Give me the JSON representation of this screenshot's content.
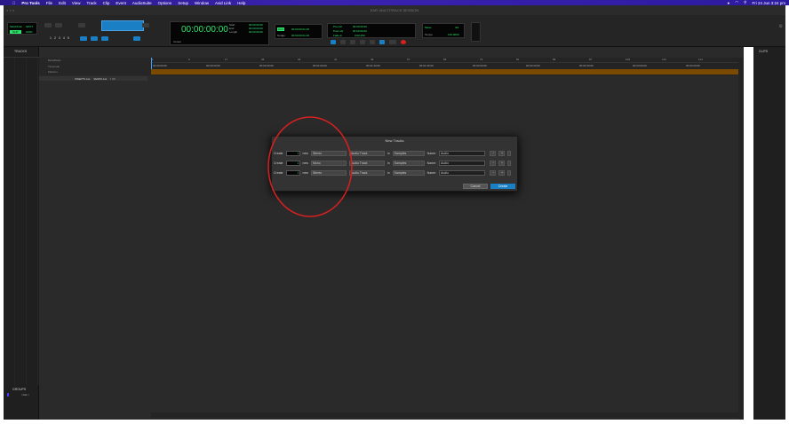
{
  "menubar": {
    "app": "Pro Tools",
    "items": [
      "File",
      "Edit",
      "View",
      "Track",
      "Clip",
      "Event",
      "AudioSuite",
      "Options",
      "Setup",
      "Window",
      "Avid Link",
      "Help"
    ],
    "datetime": "Fri 24 Jun 3:24 pm"
  },
  "window": {
    "title": "EAR: MULTITRACK SESSION"
  },
  "toolbar": {
    "modes": [
      "SHUFFLE",
      "SPOT",
      "SLIP",
      "GRID"
    ],
    "counter": "00:00:00:00",
    "start_label": "Start",
    "end_label": "End",
    "length_label": "Length",
    "start": "00:00:00:00",
    "end": "00:00:00:00",
    "length": "00:00:00:00",
    "cursor_label": "Cursor",
    "nudge_label": "Nudge",
    "nudge": "00:00:00:01.00",
    "grid": "00:00:00:01.00",
    "preroll_label": "Pre-roll",
    "postroll_label": "Post-roll",
    "fadein_label": "Fade-in",
    "preroll": "00:00:00:00",
    "postroll": "00:00:00:00",
    "fadein": "0:00.250",
    "meter": "4/4",
    "tempo": "120.0000",
    "tempo_label": "Tempo",
    "meter_label": "Meter",
    "numbers": [
      "1",
      "2",
      "3",
      "4",
      "5"
    ]
  },
  "tracks_panel": {
    "title": "TRACKS",
    "groups_title": "GROUPS",
    "group_item": "<ALL>"
  },
  "clips_panel": {
    "title": "CLIPS"
  },
  "rulers": {
    "labels": [
      "Bars|Beats",
      "Timecode",
      "Markers"
    ],
    "bars": [
      "1",
      "9",
      "17",
      "25",
      "33",
      "41",
      "49",
      "57",
      "65",
      "73",
      "81",
      "89",
      "97",
      "105",
      "113",
      "121"
    ],
    "timecodes": [
      "00:00:00:00",
      "00:00:20:00",
      "00:00:40:00",
      "00:01:00:00",
      "00:01:20:00",
      "00:01:40:00",
      "00:02:00:00",
      "00:02:20:00",
      "00:02:40:00",
      "00:03:00:00",
      "00:03:20:00"
    ],
    "track_header": [
      "INSERTS A-E",
      "SENDS A-E",
      "I / O"
    ]
  },
  "dialog": {
    "title": "New Tracks",
    "rows": [
      {
        "create": "Create",
        "count": "1",
        "new": "new",
        "format": "Stereo",
        "type": "Audio Track",
        "in": "in",
        "timebase": "Samples",
        "name_label": "Name:",
        "name": "Audio"
      },
      {
        "create": "Create",
        "count": "1",
        "new": "new",
        "format": "Mono",
        "type": "Audio Track",
        "in": "in",
        "timebase": "Samples",
        "name_label": "Name:",
        "name": "Audio"
      },
      {
        "create": "Create",
        "count": "1",
        "new": "new",
        "format": "Stereo",
        "type": "Audio Track",
        "in": "in",
        "timebase": "Samples",
        "name_label": "Name:",
        "name": "Audio"
      }
    ],
    "cancel": "Cancel",
    "create_btn": "Create",
    "minus": "−",
    "plus": "+"
  },
  "colors": {
    "accent": "#1a7fc4",
    "annotation": "#d82020",
    "lcd": "#2ee66a",
    "marker": "#7a4a00"
  }
}
